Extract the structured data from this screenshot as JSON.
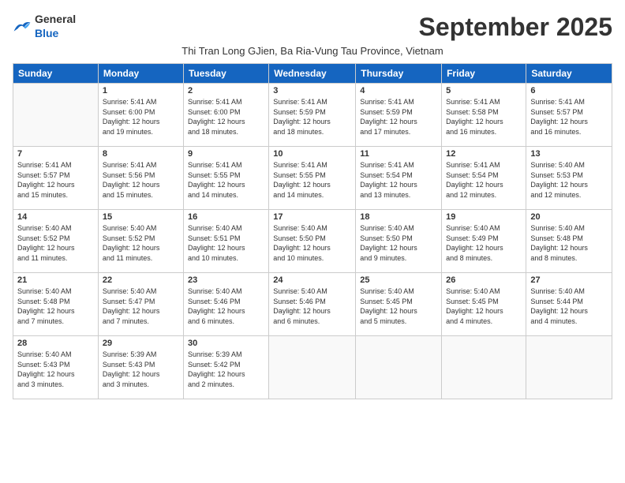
{
  "logo": {
    "general": "General",
    "blue": "Blue"
  },
  "header": {
    "month_title": "September 2025",
    "subtitle": "Thi Tran Long GJien, Ba Ria-Vung Tau Province, Vietnam"
  },
  "weekdays": [
    "Sunday",
    "Monday",
    "Tuesday",
    "Wednesday",
    "Thursday",
    "Friday",
    "Saturday"
  ],
  "weeks": [
    [
      {
        "day": "",
        "info": ""
      },
      {
        "day": "1",
        "info": "Sunrise: 5:41 AM\nSunset: 6:00 PM\nDaylight: 12 hours\nand 19 minutes."
      },
      {
        "day": "2",
        "info": "Sunrise: 5:41 AM\nSunset: 6:00 PM\nDaylight: 12 hours\nand 18 minutes."
      },
      {
        "day": "3",
        "info": "Sunrise: 5:41 AM\nSunset: 5:59 PM\nDaylight: 12 hours\nand 18 minutes."
      },
      {
        "day": "4",
        "info": "Sunrise: 5:41 AM\nSunset: 5:59 PM\nDaylight: 12 hours\nand 17 minutes."
      },
      {
        "day": "5",
        "info": "Sunrise: 5:41 AM\nSunset: 5:58 PM\nDaylight: 12 hours\nand 16 minutes."
      },
      {
        "day": "6",
        "info": "Sunrise: 5:41 AM\nSunset: 5:57 PM\nDaylight: 12 hours\nand 16 minutes."
      }
    ],
    [
      {
        "day": "7",
        "info": "Sunrise: 5:41 AM\nSunset: 5:57 PM\nDaylight: 12 hours\nand 15 minutes."
      },
      {
        "day": "8",
        "info": "Sunrise: 5:41 AM\nSunset: 5:56 PM\nDaylight: 12 hours\nand 15 minutes."
      },
      {
        "day": "9",
        "info": "Sunrise: 5:41 AM\nSunset: 5:55 PM\nDaylight: 12 hours\nand 14 minutes."
      },
      {
        "day": "10",
        "info": "Sunrise: 5:41 AM\nSunset: 5:55 PM\nDaylight: 12 hours\nand 14 minutes."
      },
      {
        "day": "11",
        "info": "Sunrise: 5:41 AM\nSunset: 5:54 PM\nDaylight: 12 hours\nand 13 minutes."
      },
      {
        "day": "12",
        "info": "Sunrise: 5:41 AM\nSunset: 5:54 PM\nDaylight: 12 hours\nand 12 minutes."
      },
      {
        "day": "13",
        "info": "Sunrise: 5:40 AM\nSunset: 5:53 PM\nDaylight: 12 hours\nand 12 minutes."
      }
    ],
    [
      {
        "day": "14",
        "info": "Sunrise: 5:40 AM\nSunset: 5:52 PM\nDaylight: 12 hours\nand 11 minutes."
      },
      {
        "day": "15",
        "info": "Sunrise: 5:40 AM\nSunset: 5:52 PM\nDaylight: 12 hours\nand 11 minutes."
      },
      {
        "day": "16",
        "info": "Sunrise: 5:40 AM\nSunset: 5:51 PM\nDaylight: 12 hours\nand 10 minutes."
      },
      {
        "day": "17",
        "info": "Sunrise: 5:40 AM\nSunset: 5:50 PM\nDaylight: 12 hours\nand 10 minutes."
      },
      {
        "day": "18",
        "info": "Sunrise: 5:40 AM\nSunset: 5:50 PM\nDaylight: 12 hours\nand 9 minutes."
      },
      {
        "day": "19",
        "info": "Sunrise: 5:40 AM\nSunset: 5:49 PM\nDaylight: 12 hours\nand 8 minutes."
      },
      {
        "day": "20",
        "info": "Sunrise: 5:40 AM\nSunset: 5:48 PM\nDaylight: 12 hours\nand 8 minutes."
      }
    ],
    [
      {
        "day": "21",
        "info": "Sunrise: 5:40 AM\nSunset: 5:48 PM\nDaylight: 12 hours\nand 7 minutes."
      },
      {
        "day": "22",
        "info": "Sunrise: 5:40 AM\nSunset: 5:47 PM\nDaylight: 12 hours\nand 7 minutes."
      },
      {
        "day": "23",
        "info": "Sunrise: 5:40 AM\nSunset: 5:46 PM\nDaylight: 12 hours\nand 6 minutes."
      },
      {
        "day": "24",
        "info": "Sunrise: 5:40 AM\nSunset: 5:46 PM\nDaylight: 12 hours\nand 6 minutes."
      },
      {
        "day": "25",
        "info": "Sunrise: 5:40 AM\nSunset: 5:45 PM\nDaylight: 12 hours\nand 5 minutes."
      },
      {
        "day": "26",
        "info": "Sunrise: 5:40 AM\nSunset: 5:45 PM\nDaylight: 12 hours\nand 4 minutes."
      },
      {
        "day": "27",
        "info": "Sunrise: 5:40 AM\nSunset: 5:44 PM\nDaylight: 12 hours\nand 4 minutes."
      }
    ],
    [
      {
        "day": "28",
        "info": "Sunrise: 5:40 AM\nSunset: 5:43 PM\nDaylight: 12 hours\nand 3 minutes."
      },
      {
        "day": "29",
        "info": "Sunrise: 5:39 AM\nSunset: 5:43 PM\nDaylight: 12 hours\nand 3 minutes."
      },
      {
        "day": "30",
        "info": "Sunrise: 5:39 AM\nSunset: 5:42 PM\nDaylight: 12 hours\nand 2 minutes."
      },
      {
        "day": "",
        "info": ""
      },
      {
        "day": "",
        "info": ""
      },
      {
        "day": "",
        "info": ""
      },
      {
        "day": "",
        "info": ""
      }
    ]
  ]
}
